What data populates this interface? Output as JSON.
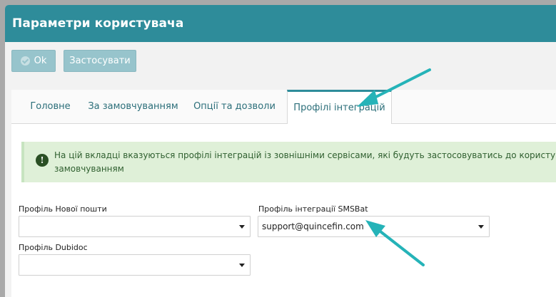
{
  "window": {
    "title": "Параметри користувача"
  },
  "toolbar": {
    "ok_label": "Ok",
    "apply_label": "Застосувати"
  },
  "tabs": [
    {
      "label": "Головне",
      "active": false
    },
    {
      "label": "За замовчуванням",
      "active": false
    },
    {
      "label": "Опції та дозволи",
      "active": false
    },
    {
      "label": "Профілі інтеграцій",
      "active": true
    }
  ],
  "info": {
    "text": "На цій вкладці вказуються профілі інтеграцій із зовнішніми сервісами, які будуть застосовуватись до користувача замовчуванням"
  },
  "fields": {
    "nova_poshta": {
      "label": "Профіль Нової пошти",
      "value": ""
    },
    "smsbat": {
      "label": "Профіль інтеграції SMSBat",
      "value": "support@quincefin.com"
    },
    "dubidoc": {
      "label": "Профіль Dubidoc",
      "value": ""
    }
  },
  "colors": {
    "accent": "#2e8c9a",
    "annotation_arrow": "#25b3b8",
    "info_bg": "#dff0d8"
  }
}
